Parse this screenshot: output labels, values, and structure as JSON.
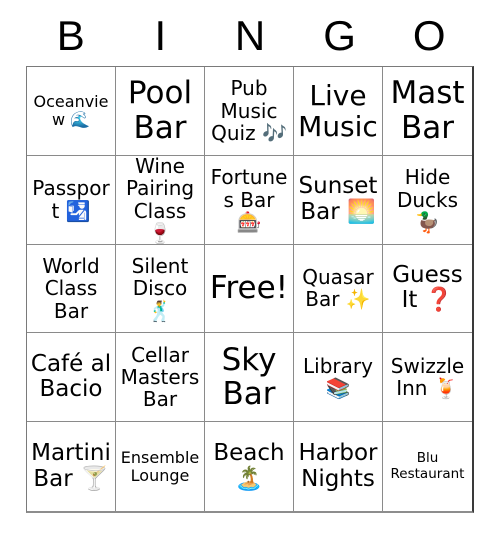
{
  "card": {
    "title": "BINGO",
    "header_letters": [
      "B",
      "I",
      "N",
      "G",
      "O"
    ],
    "free_space_label": "Free!",
    "columns": 5,
    "rows": 5,
    "colors": {
      "background": "#ffffff",
      "text": "#000000",
      "grid_line": "#8a8a8a",
      "border_outer": "#3a3a3a"
    },
    "cells": [
      {
        "text": "Oceanview 🌊",
        "size": "fs-sm"
      },
      {
        "text": "Pool Bar",
        "size": "fs-xxl"
      },
      {
        "text": "Pub Music Quiz 🎶",
        "size": "fs-md"
      },
      {
        "text": "Live Music",
        "size": "fs-xl"
      },
      {
        "text": "Mast Bar",
        "size": "fs-xxl"
      },
      {
        "text": "Passport 🛂",
        "size": "fs-md"
      },
      {
        "text": "Wine Pairing Class 🍷",
        "size": "fs-md"
      },
      {
        "text": "Fortunes Bar 🎰",
        "size": "fs-md"
      },
      {
        "text": "Sunset Bar 🌅",
        "size": "fs-lg"
      },
      {
        "text": "Hide Ducks 🦆",
        "size": "fs-md"
      },
      {
        "text": "World Class Bar",
        "size": "fs-md"
      },
      {
        "text": "Silent Disco 🕺",
        "size": "fs-md"
      },
      {
        "text": "Free!",
        "size": "fs-xxl"
      },
      {
        "text": "Quasar Bar ✨",
        "size": "fs-md"
      },
      {
        "text": "Guess It ❓",
        "size": "fs-lg"
      },
      {
        "text": "Café al Bacio",
        "size": "fs-lg"
      },
      {
        "text": "Cellar Masters Bar",
        "size": "fs-md"
      },
      {
        "text": "Sky Bar",
        "size": "fs-xxl"
      },
      {
        "text": "Library 📚",
        "size": "fs-md"
      },
      {
        "text": "Swizzle Inn 🍹",
        "size": "fs-md"
      },
      {
        "text": "Martini Bar 🍸",
        "size": "fs-lg"
      },
      {
        "text": "Ensemble Lounge",
        "size": "fs-sm"
      },
      {
        "text": "Beach 🏝️",
        "size": "fs-lg"
      },
      {
        "text": "Harbor Nights",
        "size": "fs-lg"
      },
      {
        "text": "Blu Restaurant",
        "size": "fs-xs"
      }
    ]
  }
}
